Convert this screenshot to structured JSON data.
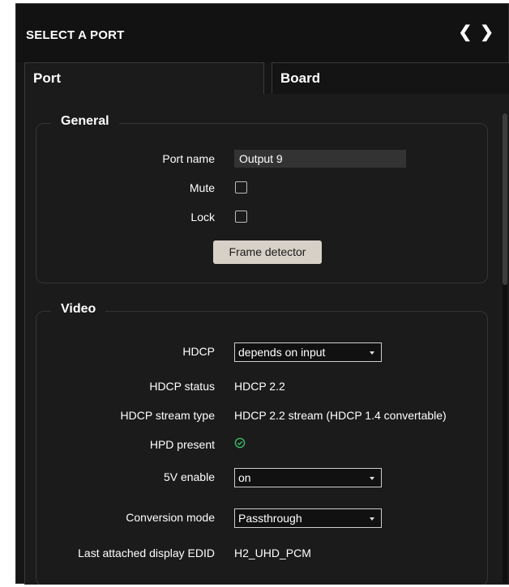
{
  "header": {
    "title": "SELECT A PORT",
    "prev_icon": "chevron-left-icon",
    "next_icon": "chevron-right-icon"
  },
  "tabs": [
    {
      "label": "Port"
    },
    {
      "label": "Board"
    }
  ],
  "general": {
    "title": "General",
    "port_name_label": "Port name",
    "port_name_value": "Output 9",
    "mute_label": "Mute",
    "lock_label": "Lock",
    "frame_detector_label": "Frame detector"
  },
  "video": {
    "title": "Video",
    "hdcp_label": "HDCP",
    "hdcp_value": "depends on input",
    "hdcp_status_label": "HDCP status",
    "hdcp_status_value": "HDCP 2.2",
    "hdcp_stream_type_label": "HDCP stream type",
    "hdcp_stream_type_value": "HDCP 2.2 stream (HDCP 1.4 convertable)",
    "hpd_present_label": "HPD present",
    "hpd_icon": "check-circle-icon",
    "five_v_enable_label": "5V enable",
    "five_v_enable_value": "on",
    "conversion_mode_label": "Conversion mode",
    "conversion_mode_value": "Passthrough",
    "last_edid_label": "Last attached display EDID",
    "last_edid_value": "H2_UHD_PCM"
  },
  "colors": {
    "panel_bg": "#1b1b1b",
    "accent_green": "#3dba6a",
    "button_bg": "#d6d0c6"
  }
}
